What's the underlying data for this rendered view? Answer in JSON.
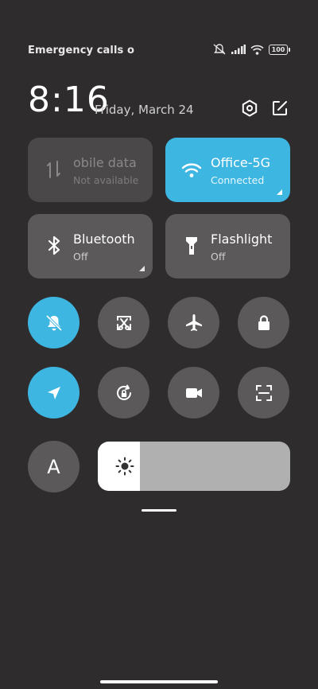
{
  "status_bar": {
    "carrier_text": "Emergency calls o",
    "battery_level": "100",
    "icons": [
      "vibrate-off-icon",
      "signal-icon",
      "wifi-icon",
      "battery-icon"
    ]
  },
  "header": {
    "time": "8:16",
    "date": "Friday, March 24",
    "icons": [
      "settings-icon",
      "edit-icon"
    ]
  },
  "tiles": [
    {
      "title": "obile data",
      "subtitle": "Not available",
      "icon": "mobile-data-icon",
      "state": "disabled"
    },
    {
      "title": "Office-5G",
      "subtitle": "Connected",
      "icon": "wifi-icon",
      "state": "active"
    },
    {
      "title": "Bluetooth",
      "subtitle": "Off",
      "icon": "bluetooth-icon",
      "state": "off"
    },
    {
      "title": "Flashlight",
      "subtitle": "Off",
      "icon": "flashlight-icon",
      "state": "off"
    }
  ],
  "toggles_row1": [
    {
      "icon": "silent-bell-icon",
      "state": "active"
    },
    {
      "icon": "screenshot-icon",
      "state": "off"
    },
    {
      "icon": "airplane-icon",
      "state": "off"
    },
    {
      "icon": "lock-icon",
      "state": "off"
    }
  ],
  "toggles_row2": [
    {
      "icon": "location-icon",
      "state": "active"
    },
    {
      "icon": "rotation-lock-icon",
      "state": "off"
    },
    {
      "icon": "screen-record-icon",
      "state": "off"
    },
    {
      "icon": "scanner-icon",
      "state": "off"
    }
  ],
  "bottom": {
    "font_button_label": "A",
    "brightness_level": 0.22
  },
  "colors": {
    "background": "#2e2c2c",
    "accent": "#3eb6e2",
    "tile": "#5b5959"
  }
}
